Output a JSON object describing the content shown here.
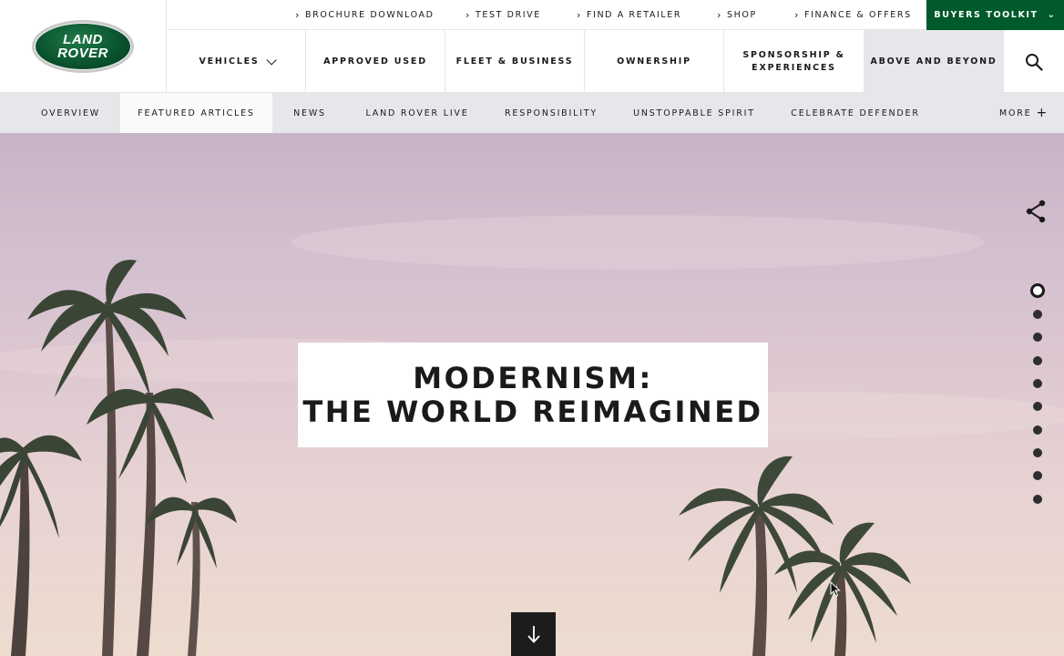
{
  "brand": {
    "logo_line1": "LAND",
    "logo_line2": "ROVER",
    "accent": "#005a2b"
  },
  "utility_links": [
    {
      "label": "BROCHURE DOWNLOAD"
    },
    {
      "label": "TEST DRIVE"
    },
    {
      "label": "FIND A RETAILER"
    },
    {
      "label": "SHOP"
    },
    {
      "label": "FINANCE & OFFERS"
    }
  ],
  "buyers_toolkit": {
    "label": "BUYERS TOOLKIT"
  },
  "main_nav": [
    {
      "label": "VEHICLES"
    },
    {
      "label": "APPROVED USED"
    },
    {
      "label": "FLEET & BUSINESS"
    },
    {
      "label": "OWNERSHIP"
    },
    {
      "label": "SPONSORSHIP &",
      "label2": "EXPERIENCES"
    },
    {
      "label": "ABOVE AND BEYOND"
    }
  ],
  "sub_nav": [
    {
      "label": "OVERVIEW"
    },
    {
      "label": "FEATURED ARTICLES"
    },
    {
      "label": "NEWS"
    },
    {
      "label": "LAND ROVER LIVE"
    },
    {
      "label": "RESPONSIBILITY"
    },
    {
      "label": "UNSTOPPABLE SPIRIT"
    },
    {
      "label": "CELEBRATE DEFENDER"
    },
    {
      "label": "MORE"
    }
  ],
  "hero": {
    "title_line1": "MODERNISM:",
    "title_line2": "THE WORLD REIMAGINED",
    "section_count": 10,
    "current_section": 1
  }
}
